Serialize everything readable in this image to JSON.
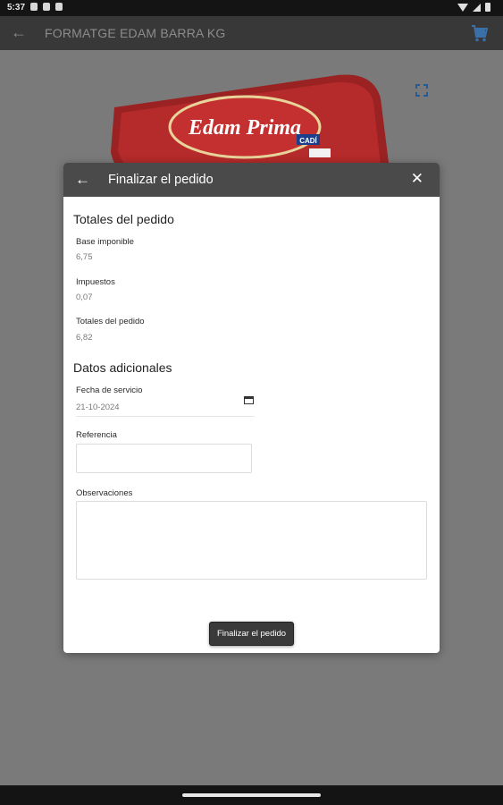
{
  "status_bar": {
    "time": "5:37"
  },
  "app_bar": {
    "back_icon": "arrow-left-icon",
    "title": "FORMATGE EDAM BARRA KG",
    "cart_icon": "shopping-cart-icon",
    "cart_color": "#3a7fc4"
  },
  "product": {
    "image_label": "Edam Prima",
    "image_brand": "CADÍ",
    "expand_icon": "fullscreen-icon",
    "accent_color": "#3a7fc4"
  },
  "dialog": {
    "title": "Finalizar el pedido",
    "back_icon": "arrow-left-icon",
    "close_icon": "close-icon",
    "header_color": "#4a4a4a",
    "totals_section": {
      "title": "Totales del pedido",
      "base_label": "Base imponible",
      "base_value": "6,75",
      "tax_label": "Impuestos",
      "tax_value": "0,07",
      "total_label": "Totales del pedido",
      "total_value": "6,82"
    },
    "additional_section": {
      "title": "Datos adicionales",
      "service_date_label": "Fecha de servicio",
      "service_date_value": "21-10-2024",
      "calendar_icon": "calendar-icon",
      "reference_label": "Referencia",
      "reference_value": "",
      "notes_label": "Observaciones",
      "notes_value": ""
    },
    "submit_label": "Finalizar el pedido"
  }
}
